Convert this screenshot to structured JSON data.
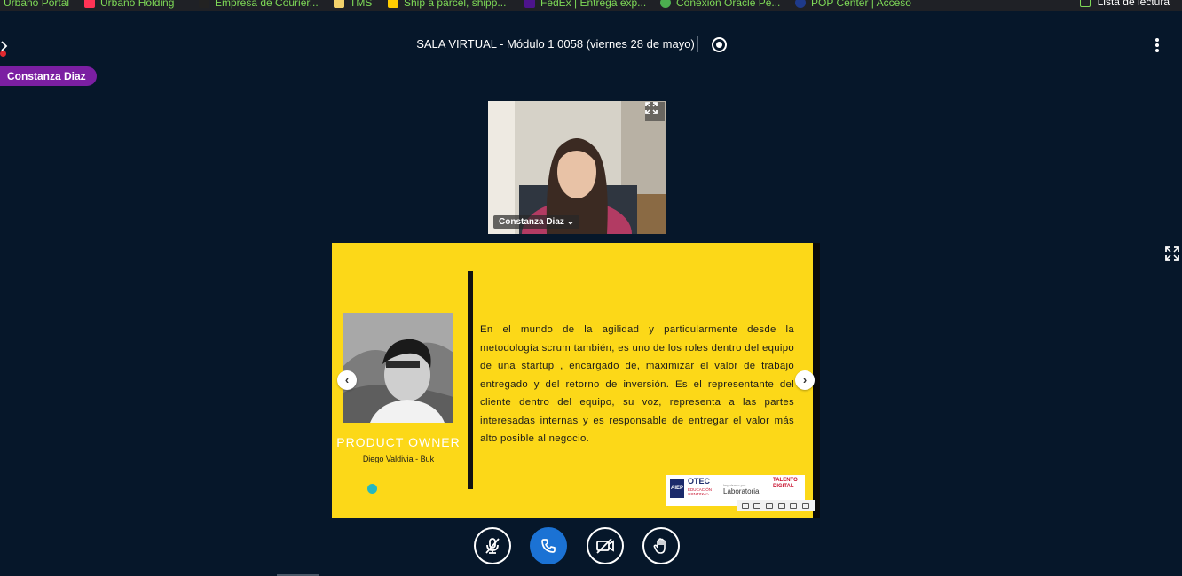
{
  "bookmarks_bar": {
    "items": [
      {
        "label": "Urbano Portal",
        "icon": "page-icon",
        "color": "#7ed957"
      },
      {
        "label": "Urbano Holding",
        "icon": "tiktok-icon",
        "color": "#ff3355"
      },
      {
        "label": "Empresa de Courier...",
        "icon": "courier-icon",
        "color": "#333333"
      },
      {
        "label": "TMS",
        "icon": "folder-icon",
        "color": "#f2d16b"
      },
      {
        "label": "Ship a parcel, shipp...",
        "icon": "dhl-icon",
        "color": "#ffcc00"
      },
      {
        "label": "FedEx | Entrega exp...",
        "icon": "fedex-icon",
        "color": "#4d148c"
      },
      {
        "label": "Conexión Oracle Pe...",
        "icon": "globe-icon",
        "color": "#4caf50"
      },
      {
        "label": "POP Center | Acceso",
        "icon": "pop-icon",
        "color": "#1e3a8a"
      }
    ],
    "reading_list": "Lista de lectura"
  },
  "header": {
    "session_title": "SALA VIRTUAL - Módulo 1 0058 (viernes 28 de mayo)"
  },
  "talking_indicator": "Constanza Diaz",
  "webcam": {
    "name": "Constanza Diaz"
  },
  "presentation": {
    "role": "PRODUCT OWNER",
    "person": "Diego Valdivia - Buk",
    "body": "En el mundo de la agilidad y particularmente desde la metodología scrum también, es uno de los roles dentro del equipo de una startup , encargado de, maximizar el valor de trabajo entregado y del retorno de inversión. Es el representante del cliente dentro del equipo, su voz, representa a las partes interesadas internas y es responsable de entregar el valor más alto posible al negocio.",
    "logos": {
      "aiep": "AIEP",
      "otec": "OTEC",
      "otec_sub": "EDUCACIÓN CONTINUA",
      "lab_small": "Impulsado por",
      "laboratoria": "Laboratoria",
      "talento": "TALENTO DIGITAL"
    },
    "prev_arrow": "‹",
    "next_arrow": "›"
  },
  "colors": {
    "background": "#06172a",
    "slide_yellow": "#fcd818",
    "accent_blue": "#1b72d4",
    "talker_purple": "#7b1fa2",
    "bookmark_green": "#7ed957"
  },
  "controls": [
    {
      "name": "mute-button",
      "icon": "mic-off-icon"
    },
    {
      "name": "leave-audio-button",
      "icon": "phone-icon"
    },
    {
      "name": "share-webcam-button",
      "icon": "camera-off-icon"
    },
    {
      "name": "raise-hand-button",
      "icon": "hand-icon"
    }
  ]
}
